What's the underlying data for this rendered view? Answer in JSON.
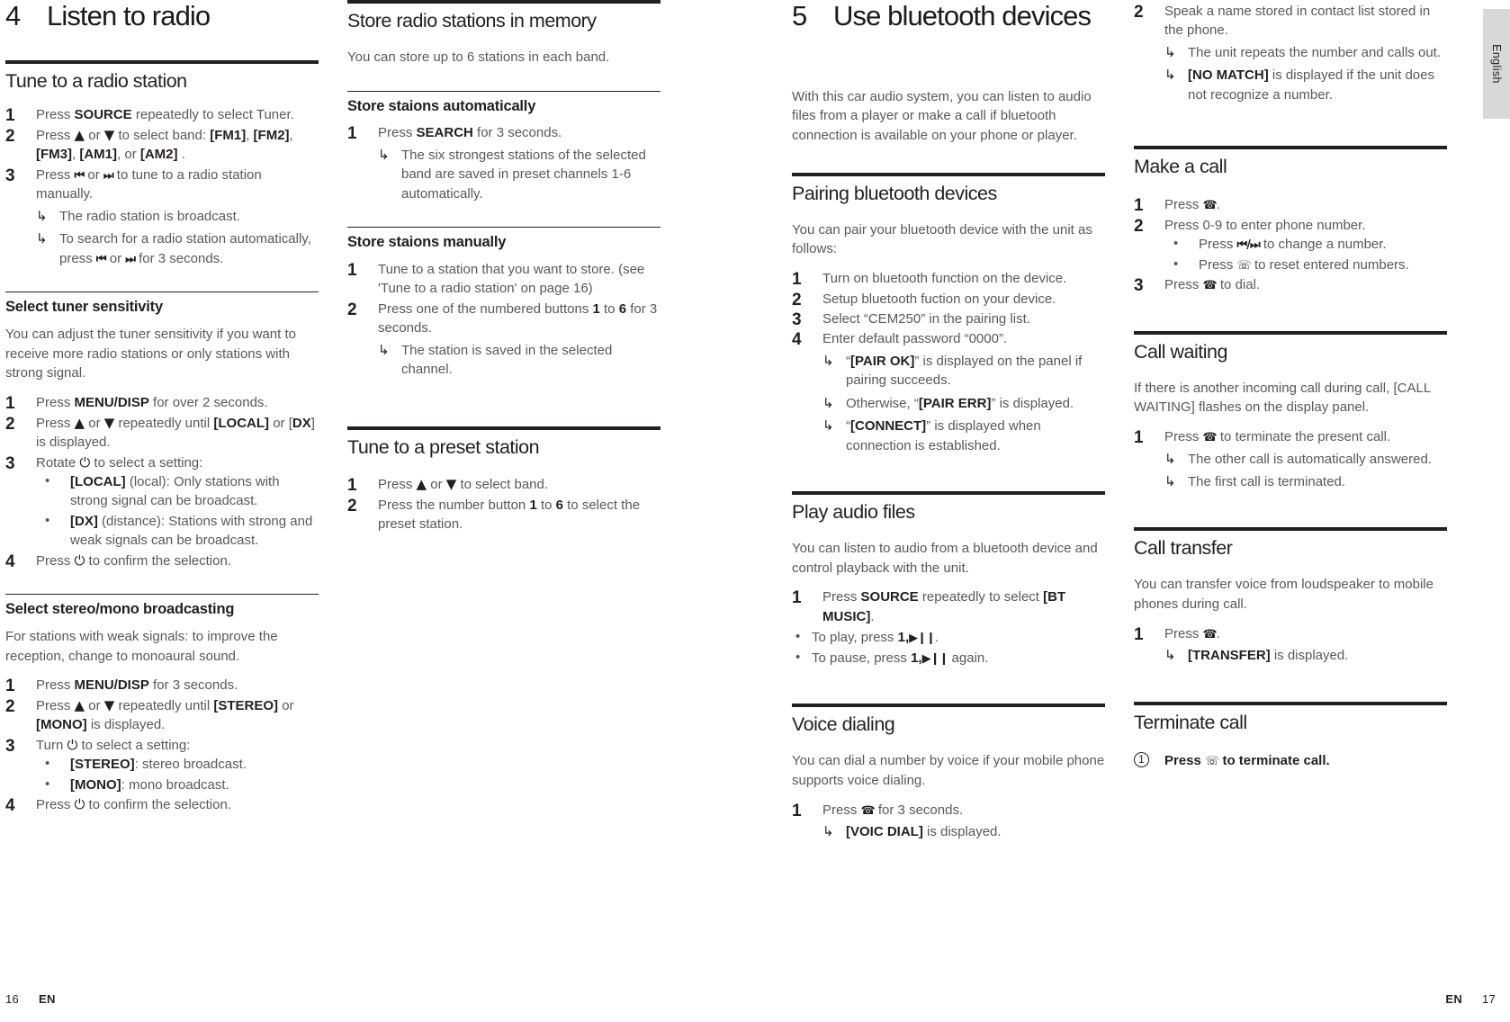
{
  "left_page": {
    "chapter": {
      "number": "4",
      "title": "Listen to radio"
    },
    "footer": {
      "page": "16",
      "lang": "EN"
    },
    "col1": {
      "sec_tune": {
        "title": "Tune to a radio station",
        "s1": {
          "pre": "Press ",
          "bold": "SOURCE",
          "post": " repeatedly to select Tuner."
        },
        "s2": {
          "text": "Press ▲ or ▼ to select band: [FM1], [FM2], [FM3], [AM1], or [AM2] ."
        },
        "s3": {
          "text": "Press |◄◄ or ►►| to tune to a radio station manually."
        },
        "r1": "The radio station is broadcast.",
        "r2": "To search for a radio station automatically, press |◄◄ or ►►| for 3 seconds."
      },
      "sec_sensitivity": {
        "title": "Select tuner sensitivity",
        "intro": "You can adjust the tuner sensitivity if you want to receive more radio stations or only stations with strong signal.",
        "s1": {
          "pre": "Press ",
          "bold": "MENU/DISP",
          "post": " for over 2 seconds."
        },
        "s2": {
          "text": "Press ▲ or ▼ repeatedly until [LOCAL] or [DX] is displayed."
        },
        "s3": {
          "text": "Rotate ⏻ to select a setting:"
        },
        "b1": {
          "bold": "[LOCAL]",
          "post": " (local): Only stations with strong signal can be broadcast."
        },
        "b2": {
          "bold": "[DX]",
          "post": " (distance): Stations with strong and weak signals can be broadcast."
        },
        "s4": {
          "text": "Press ⏻ to confirm the selection."
        }
      },
      "sec_stereo": {
        "title": "Select stereo/mono broadcasting",
        "intro": "For stations with weak signals: to improve the reception, change to monoaural sound.",
        "s1": {
          "pre": "Press ",
          "bold": "MENU/DISP",
          "post": " for 3 seconds."
        },
        "s2": {
          "text": "Press ▲ or ▼ repeatedly until [STEREO] or [MONO] is displayed."
        },
        "s3": {
          "text": "Turn ⏻ to select a setting:"
        },
        "b1": {
          "bold": "[STEREO]",
          "post": ": stereo broadcast."
        },
        "b2": {
          "bold": "[MONO]",
          "post": ": mono broadcast."
        },
        "s4": {
          "text": "Press ⏻ to confirm the selection."
        }
      }
    },
    "col2": {
      "sec_store": {
        "title": "Store radio stations in memory",
        "intro": "You can store up to 6 stations in each band."
      },
      "sub_auto": {
        "title": "Store staions automatically",
        "s1": {
          "pre": "Press ",
          "bold": "SEARCH",
          "post": " for 3 seconds."
        },
        "r1": "The six strongest stations of the selected band are saved in preset channels 1-6 automatically."
      },
      "sub_manual": {
        "title": "Store staions manually",
        "s1": "Tune to a station that you want to store. (see 'Tune to a radio station' on page 16)",
        "s2": {
          "text": "Press one of the numbered buttons 1 to 6 for 3 seconds."
        },
        "r1": "The station is saved in the selected channel."
      },
      "sec_preset": {
        "title": "Tune to a preset station",
        "s1": "Press ▲ or ▼ to select band.",
        "s2": {
          "text": "Press the number button 1 to 6 to select the preset station."
        }
      }
    }
  },
  "right_page": {
    "chapter": {
      "number": "5",
      "title": "Use bluetooth devices"
    },
    "footer": {
      "page": "17",
      "lang": "EN"
    },
    "side_tab": "English",
    "col3": {
      "intro": "With this car audio system, you can listen to audio files from a player or make a call if bluetooth connection is available on your phone or player.",
      "sec_pairing": {
        "title": "Pairing bluetooth devices",
        "intro": "You can pair your bluetooth device with the unit as follows:",
        "s1": "Turn on bluetooth function on the device.",
        "s2": "Setup bluetooth fuction on your device.",
        "s3": "Select “CEM250” in the pairing list.",
        "s4": "Enter default password “0000”.",
        "r1": {
          "pre": "“",
          "bold": "[PAIR OK]",
          "post": "” is displayed on the panel if pairing succeeds."
        },
        "r2": {
          "pre": "Otherwise, “",
          "bold": "[PAIR ERR]",
          "post": "” is displayed."
        },
        "r3": {
          "pre": "“",
          "bold": "[CONNECT]",
          "post": "” is displayed when connection is established."
        }
      },
      "sec_play": {
        "title": "Play audio files",
        "intro": "You can listen to audio from a bluetooth device and control playback with the unit.",
        "s1": {
          "pre": "Press ",
          "bold": "SOURCE",
          "mid": " repeatedly to select ",
          "bold2": "[BT MUSIC]",
          "post": "."
        },
        "b1": {
          "pre": "To play, press ",
          "bold": "1,►❙❙",
          "post": "."
        },
        "b2": {
          "pre": "To pause, press ",
          "bold": "1,►❙❙",
          "post": " again."
        }
      },
      "sec_voice": {
        "title": "Voice dialing",
        "intro": "You can dial a number by voice if your mobile phone supports voice dialing.",
        "s1": "Press ✆ for 3 seconds.",
        "r1": {
          "bold": "[VOIC DIAL]",
          "post": " is displayed."
        }
      }
    },
    "col4": {
      "voice_cont": {
        "s2": "Speak a name stored in contact list stored in the phone.",
        "r1": "The unit repeats the number and calls out.",
        "r2": {
          "bold": "[NO MATCH]",
          "post": " is displayed if the unit does not recognize a number."
        }
      },
      "sec_make_call": {
        "title": "Make a call",
        "s1": "Press ✆.",
        "s2": "Press 0-9 to enter phone number.",
        "b1": "Press |◄◄/►►| to change a number.",
        "b2": "Press ☎ to reset entered numbers.",
        "s3": "Press ✆ to dial."
      },
      "sec_call_waiting": {
        "title": "Call waiting",
        "intro": "If there is another incoming call during call, [CALL WAITING] flashes on the display panel.",
        "s1": "Press ✆ to terminate the present call.",
        "r1": "The other call is automatically answered.",
        "r2": "The first call is terminated."
      },
      "sec_call_transfer": {
        "title": "Call transfer",
        "intro": "You can transfer voice from loudspeaker to mobile phones during call.",
        "s1": "Press ✆.",
        "r1": {
          "bold": "[TRANSFER]",
          "post": " is displayed."
        }
      },
      "sec_terminate": {
        "title": "Terminate call",
        "s1": {
          "pre": "Press ",
          "glyph": "☎",
          "post": " to terminate call."
        }
      }
    }
  }
}
